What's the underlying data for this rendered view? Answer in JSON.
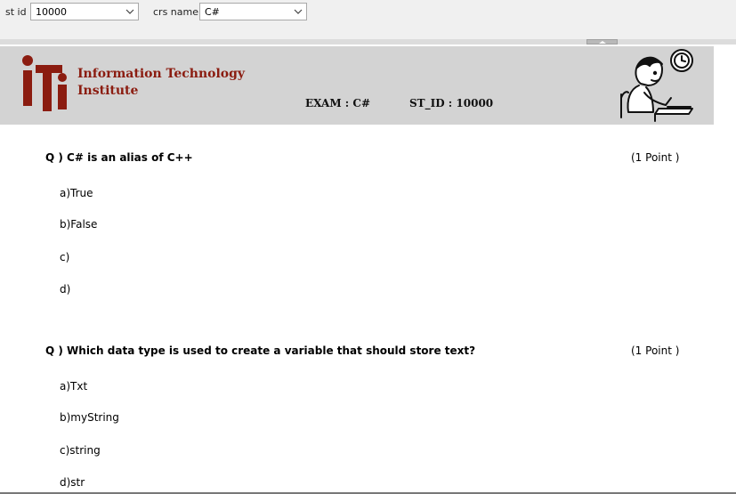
{
  "params": {
    "st_id_label": "st id",
    "st_id_value": "10000",
    "crs_name_label": "crs name",
    "crs_name_value": "C#"
  },
  "header": {
    "logo_text": "iTi",
    "institute_line1": "Information Technology",
    "institute_line2": "Institute",
    "exam_label": "EXAM :  C#",
    "st_id_label": "ST_ID  : 10000",
    "brand_color": "#8b1c10",
    "header_bg": "#d3d3d3"
  },
  "questions": [
    {
      "text": "Q ) C# is an alias of C++",
      "points": "(1 Point )",
      "choices": [
        "a)True",
        "b)False",
        "c)",
        "d)"
      ]
    },
    {
      "text": "Q ) Which data type is used to create a variable that should store text?",
      "points": "(1 Point )",
      "choices": [
        "a)Txt",
        "b)myString",
        "c)string",
        "d)str"
      ]
    }
  ]
}
